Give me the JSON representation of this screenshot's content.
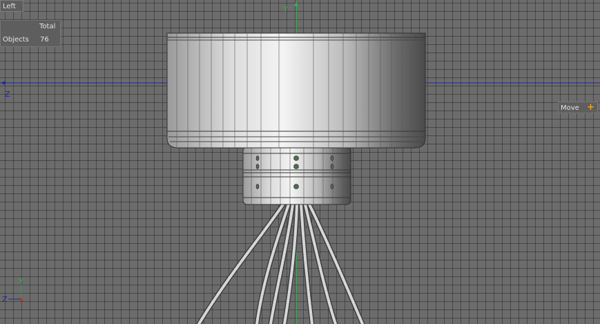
{
  "viewport": {
    "view_name": "Left",
    "stats": {
      "column_header": "Total",
      "row_label": "Objects",
      "row_value": "76"
    },
    "tool_button": {
      "label": "Move",
      "icon": "plus-icon"
    },
    "axis_labels": {
      "vertical": "Y",
      "horizontal": "Z"
    },
    "gizmo_labels": {
      "vertical": "Y",
      "horizontal": "Z"
    }
  },
  "colors": {
    "grid_background": "#6c6c6c",
    "horizontal_axis": "#1e2aa0",
    "vertical_axis": "#2fb34a",
    "accent": "#f3a21a"
  }
}
